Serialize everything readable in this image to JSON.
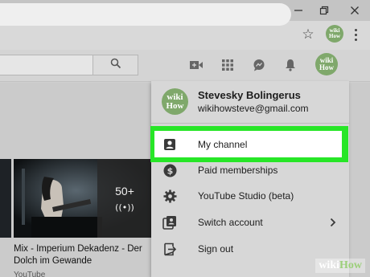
{
  "browser": {
    "profile_badge": [
      "wiki",
      "How"
    ]
  },
  "youtube": {
    "header_avatar": [
      "wiki",
      "How"
    ],
    "video": {
      "playlist_count": "50+",
      "title": "Mix - Imperium Dekadenz - Der Dolch im Gewande",
      "channel": "YouTube"
    }
  },
  "account_menu": {
    "avatar": [
      "wiki",
      "How"
    ],
    "name": "Stevesky Bolingerus",
    "email": "wikihowsteve@gmail.com",
    "items": [
      {
        "label": "My channel",
        "icon": "person-box-icon",
        "highlighted": true
      },
      {
        "label": "Paid memberships",
        "icon": "dollar-circle-icon"
      },
      {
        "label": "YouTube Studio (beta)",
        "icon": "gear-icon"
      },
      {
        "label": "Switch account",
        "icon": "switch-account-icon",
        "has_submenu": true
      },
      {
        "label": "Sign out",
        "icon": "sign-out-icon"
      }
    ]
  },
  "highlight_color": "#27e627",
  "watermark": {
    "part1": "wiki",
    "part2": "How"
  }
}
